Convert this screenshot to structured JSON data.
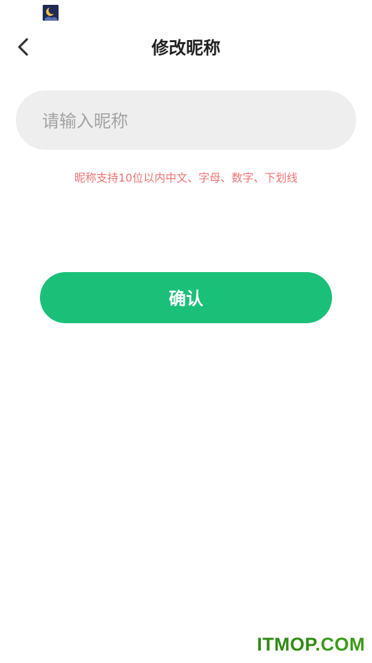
{
  "status_bar": {
    "app_icon": "moon-icon"
  },
  "nav": {
    "back_icon": "chevron-left-icon",
    "title": "修改昵称"
  },
  "nickname": {
    "value": "",
    "placeholder": "请输入昵称",
    "hint": "昵称支持10位以内中文、字母、数字、下划线"
  },
  "actions": {
    "confirm_label": "确认"
  },
  "watermark": {
    "text_a": "ITMOP",
    "text_b": ".COM"
  },
  "colors": {
    "accent": "#1bc078",
    "hint": "#f07373",
    "input_bg": "#eeeeee",
    "title": "#222222",
    "watermark": "#2f8a12"
  }
}
